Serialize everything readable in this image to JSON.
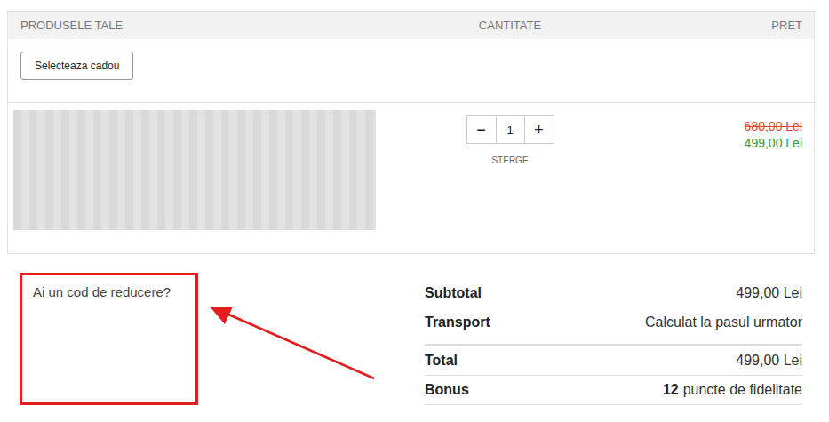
{
  "cart": {
    "columns": [
      "PRODUSELE TALE",
      "CANTITATE",
      "PRET"
    ],
    "gift_button": "Selecteaza cadou",
    "items": [
      {
        "quantity": "1",
        "minus": "−",
        "plus": "+",
        "remove": "STERGE",
        "old_price": "680,00 Lei",
        "price": "499,00 Lei"
      }
    ]
  },
  "coupon": {
    "label": "Ai un cod de reducere?",
    "highlighted": true
  },
  "summary": {
    "subtotals": [
      {
        "label": "Subtotal",
        "value": "499,00 Lei"
      },
      {
        "label": "Transport",
        "value": "Calculat la pasul urmator"
      }
    ],
    "totals": [
      {
        "label": "Total",
        "value": "499,00 Lei"
      },
      {
        "label": "Bonus",
        "value_bold": "12",
        "value": "puncte de fidelitate"
      }
    ]
  }
}
